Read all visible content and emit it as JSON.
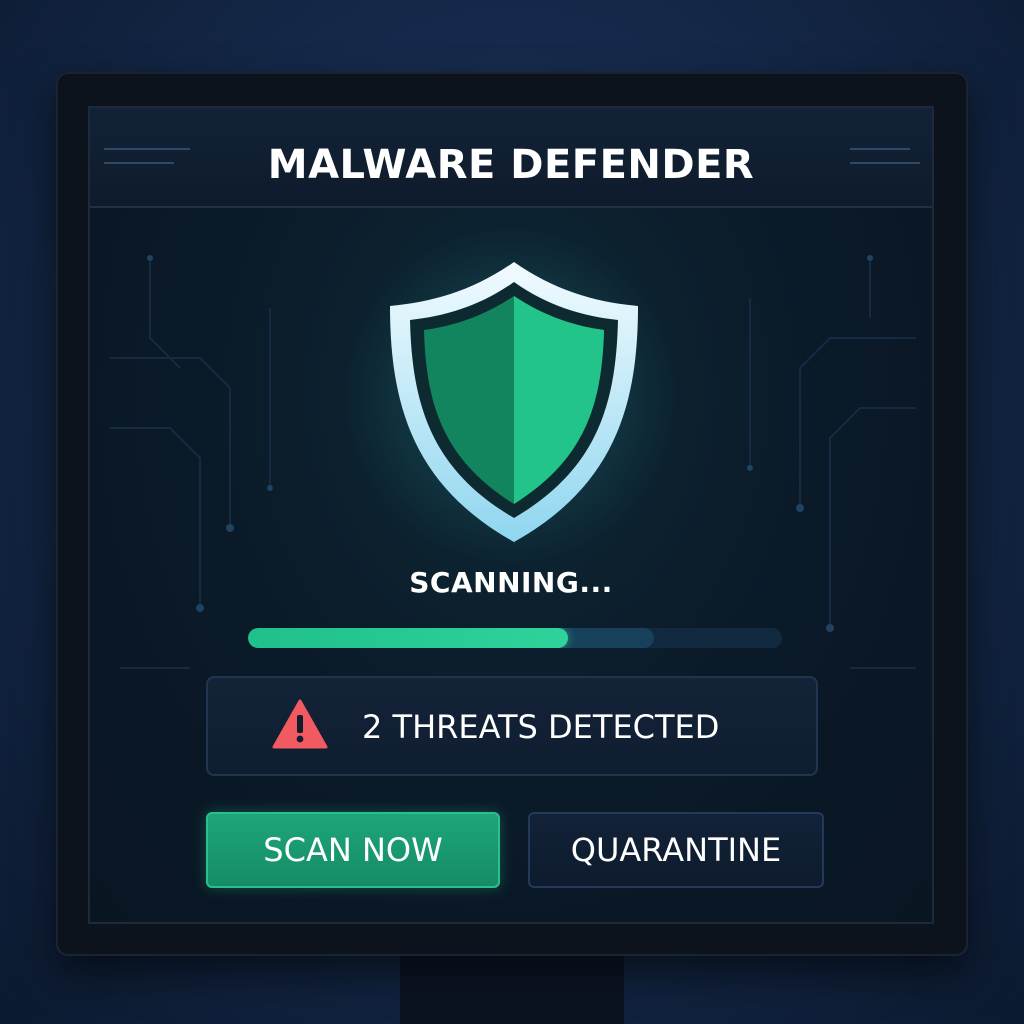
{
  "app": {
    "title": "MALWARE DEFENDER"
  },
  "scan": {
    "status": "SCANNING...",
    "progress": 0.6,
    "buffer": 0.76
  },
  "threats": {
    "message": "2 THREATS DETECTED",
    "icon": "warning-triangle-icon"
  },
  "actions": {
    "scan_now_label": "SCAN NOW",
    "quarantine_label": "QUARANTINE"
  },
  "icons": {
    "shield": "shield-icon",
    "warning": "warning-icon"
  },
  "colors": {
    "accent_green": "#1fc08a",
    "warning_red": "#f05a60",
    "shield_light": "#2fd39a",
    "shield_dark": "#12855f"
  }
}
